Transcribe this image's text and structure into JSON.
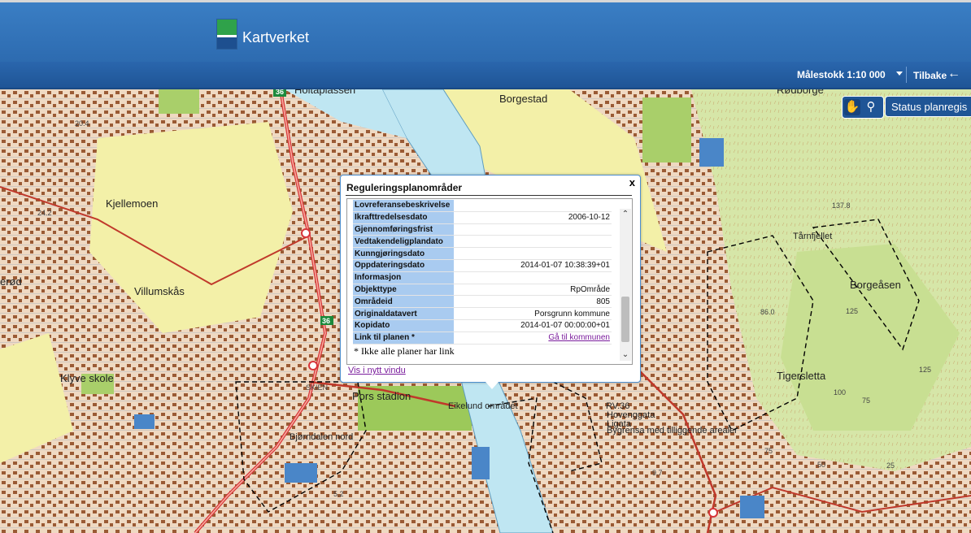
{
  "header": {
    "brand": "Kartverket"
  },
  "toolbar": {
    "scale_label": "Målestokk 1:10 000",
    "back_label": "Tilbake"
  },
  "map_controls": {
    "pan_icon": "hand-icon",
    "zoom_icon": "magnifier-icon",
    "status_button": "Status planregis"
  },
  "map_labels": {
    "holtaplassen": "Holtaplassen",
    "borgestad": "Borgestad",
    "roborg": "Rødborge",
    "kjellemoen": "Kjellemoen",
    "villumskas": "Villumskås",
    "kjored": "erød",
    "klyve_skole": "Klyve skole",
    "pors_stadion": "Pors stadion",
    "eikelund": "Eikelund området",
    "bjorndalen": "Bjørndalen nord",
    "tarnfjellet": "Tårnfjellet",
    "borgeasen": "Borgeåsen",
    "tigersletta": "Tigersletta",
    "rv36": "RV.36",
    "hoveng": "Hovenggata",
    "ligata": "Ligata",
    "bygrensa": "Bygrensa med tilliggende arealer",
    "road36a": "36",
    "road36b": "36",
    "e18": "SKIEN",
    "n204": "20.4",
    "n242": "24.2",
    "n1378": "137.8",
    "n860": "86.0",
    "n125a": "125",
    "n125b": "125",
    "n100": "100",
    "n75a": "75",
    "n75b": "75",
    "n50": "50",
    "n25": "25",
    "n52": "5.2",
    "n97": "9.7"
  },
  "popup": {
    "title": "Reguleringsplanområder",
    "close_icon": "close-icon",
    "rows": [
      {
        "key": "Lovreferansebeskrivelse",
        "value": ""
      },
      {
        "key": "Ikrafttredelsesdato",
        "value": "2006-10-12"
      },
      {
        "key": "Gjennomføringsfrist",
        "value": ""
      },
      {
        "key": "Vedtakendeligplandato",
        "value": ""
      },
      {
        "key": "Kunngjøringsdato",
        "value": ""
      },
      {
        "key": "Oppdateringsdato",
        "value": "2014-01-07 10:38:39+01"
      },
      {
        "key": "Informasjon",
        "value": ""
      },
      {
        "key": "Objekttype",
        "value": "RpOmråde"
      },
      {
        "key": "Områdeid",
        "value": "805"
      },
      {
        "key": "Originaldatavert",
        "value": "Porsgrunn kommune"
      },
      {
        "key": "Kopidato",
        "value": "2014-01-07 00:00:00+01"
      },
      {
        "key": "Link til planen *",
        "value": "Gå til kommunen"
      }
    ],
    "note": "* Ikke alle planer har link",
    "open_new_window": "Vis i nytt vindu"
  }
}
